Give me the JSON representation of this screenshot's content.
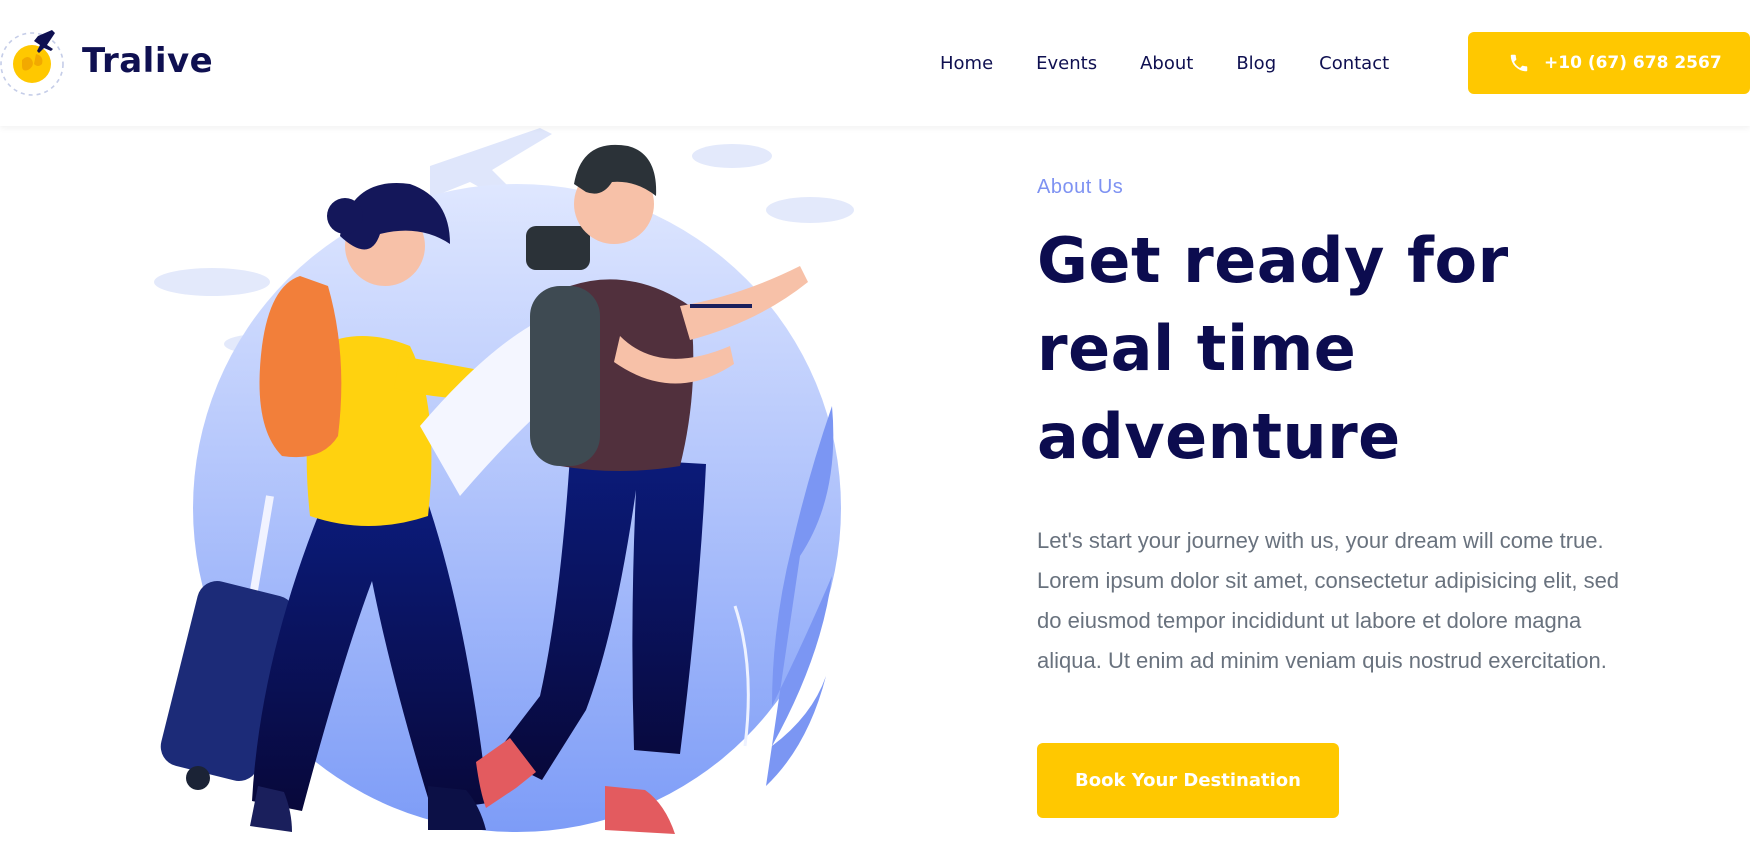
{
  "brand": {
    "name": "Tralive",
    "logo_icon": "globe-plane-icon",
    "accent": "#ffc800",
    "navy": "#0f1051"
  },
  "nav": {
    "items": [
      {
        "label": "Home"
      },
      {
        "label": "Events"
      },
      {
        "label": "About"
      },
      {
        "label": "Blog"
      },
      {
        "label": "Contact"
      }
    ]
  },
  "phone": {
    "icon": "phone-icon",
    "label": "+10 (67) 678 2567"
  },
  "hero": {
    "illustration": "travelers-illustration",
    "eyebrow": "About Us",
    "headline": "Get ready for real time adventure",
    "description": "Let's start your journey with us, your dream will come true. Lorem ipsum dolor sit amet, consectetur adipisicing elit, sed do eiusmod tempor incididunt ut labore et dolore magna aliqua. Ut enim ad minim veniam quis nostrud exercitation.",
    "cta_label": "Book Your Destination"
  }
}
